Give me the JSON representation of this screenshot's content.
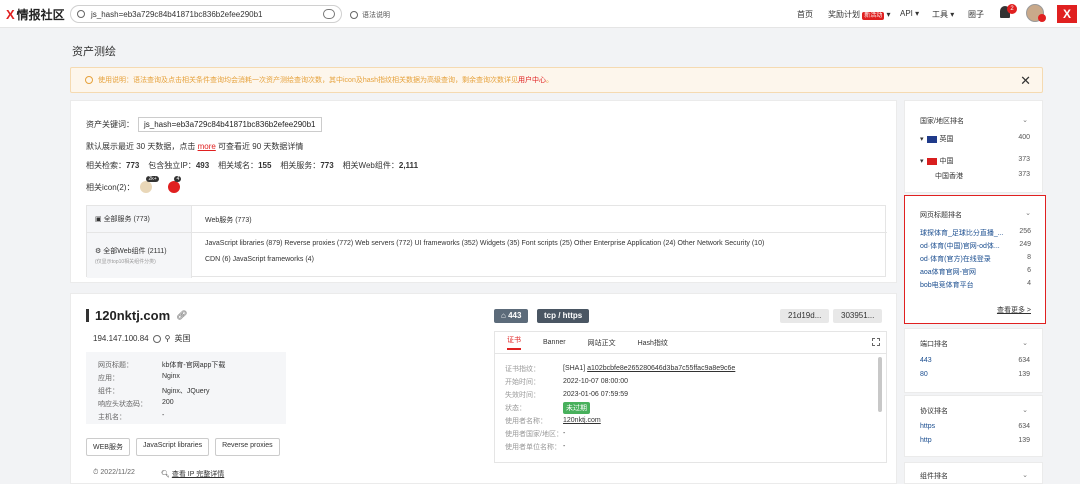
{
  "header": {
    "logo": "情报社区",
    "search_value": "js_hash=eb3a729c84b41871bc836b2efee290b1",
    "search_hint": "语法说明",
    "nav": [
      {
        "label": "首页"
      },
      {
        "label": "奖励计划",
        "badge": "新活动"
      },
      {
        "label": "API"
      },
      {
        "label": "工具"
      },
      {
        "label": "圈子"
      }
    ],
    "notifications": "2"
  },
  "page_title": "资产测绘",
  "notice": {
    "text": "使用说明：语法查询及点击相关条件查询均会消耗一次资产测绘查询次数，其中icon及hash指纹相关数据为高级查询，剩余查询次数详见",
    "link": "用户中心",
    "end": "。"
  },
  "summary": {
    "kw_label": "资产关键词：",
    "keyword": "js_hash=eb3a729c84b41871bc836b2efee290b1",
    "default_text": "默认展示最近 30 天数据，点击",
    "more": "more",
    "default_text2": "可查看近 90 天数据详情",
    "stats": [
      {
        "label": "相关检索：",
        "value": "773"
      },
      {
        "label": "包含独立IP：",
        "value": "493"
      },
      {
        "label": "相关域名：",
        "value": "155"
      },
      {
        "label": "相关服务：",
        "value": "773"
      },
      {
        "label": "相关Web组件：",
        "value": "2,111"
      }
    ],
    "icons_label": "相关icon(2)：",
    "icon_badges": [
      "2k+",
      "4"
    ]
  },
  "services": {
    "all_label": "全部服务 (773)",
    "all_value": "Web服务 (773)",
    "web_label": "全部Web组件 (2111)",
    "web_sub": "(仅显示top10相关组件分类)",
    "web_line1": "JavaScript libraries (879)    Reverse proxies (772)    Web servers (772)    UI frameworks (352)    Widgets (35)    Font scripts (25)    Other Enterprise Application (24)    Other Network Security (10)",
    "web_line2": "CDN (6)    JavaScript frameworks (4)"
  },
  "host": {
    "name": "120nktj.com",
    "ip": "194.147.100.84",
    "country": "英国",
    "info": [
      {
        "k": "网页标题：",
        "v": "kb体育-官网app下载"
      },
      {
        "k": "应用：",
        "v": "Nginx"
      },
      {
        "k": "组件：",
        "v": "Nginx、JQuery"
      },
      {
        "k": "响应头状态码：",
        "v": "200"
      },
      {
        "k": "主机名：",
        "v": "-"
      }
    ],
    "tags": [
      "WEB服务",
      "JavaScript libraries",
      "Reverse proxies"
    ],
    "date": "2022/11/22",
    "ip_link": "查看 IP 完整详情",
    "port": "443",
    "proto": "tcp / https",
    "hash1": "21d19d...",
    "hash2": "303951...",
    "tabs": [
      "证书",
      "Banner",
      "网站正文",
      "Hash指纹"
    ],
    "cert": [
      {
        "k": "证书指纹：",
        "v": "[SHA1]",
        "link": "a102bcbfe8e265280646d3ba7c55ffac9a8e9c6e"
      },
      {
        "k": "开始时间：",
        "v": "2022-10-07 08:00:00"
      },
      {
        "k": "失效时间：",
        "v": "2023-01-06 07:59:59"
      },
      {
        "k": "状态：",
        "badge": "未过期"
      },
      {
        "k": "使用者名称：",
        "link": "120nktj.com"
      },
      {
        "k": "使用者国家/地区：",
        "v": "-"
      },
      {
        "k": "使用者单位名称：",
        "v": "-"
      }
    ]
  },
  "sidebar": {
    "country": {
      "title": "国家/地区排名",
      "items": [
        {
          "label": "英国",
          "v": "400"
        },
        {
          "label": "中国",
          "v": "373"
        },
        {
          "label": "中国香港",
          "v": "373"
        }
      ]
    },
    "title_rank": {
      "title": "网页标题排名",
      "items": [
        {
          "label": "球探体育_足球比分直播_...",
          "v": "256"
        },
        {
          "label": "od·体育(中国)官网-od体...",
          "v": "249"
        },
        {
          "label": "od·体育(官方)在线登录",
          "v": "8"
        },
        {
          "label": "aoa体育官网-官网",
          "v": "6"
        },
        {
          "label": "bob电竞体育平台",
          "v": "4"
        }
      ],
      "more": "查看更多 >"
    },
    "port": {
      "title": "端口排名",
      "items": [
        {
          "label": "443",
          "v": "634"
        },
        {
          "label": "80",
          "v": "139"
        }
      ]
    },
    "proto": {
      "title": "协议排名",
      "items": [
        {
          "label": "https",
          "v": "634"
        },
        {
          "label": "http",
          "v": "139"
        }
      ]
    },
    "comp": {
      "title": "组件排名"
    }
  }
}
